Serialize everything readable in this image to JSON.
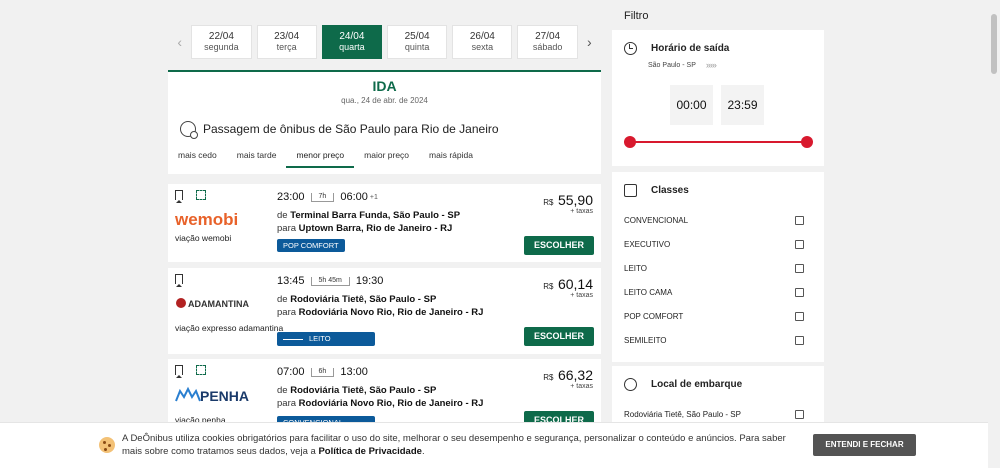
{
  "dates": [
    {
      "date": "22/04",
      "weekday": "segunda",
      "active": false
    },
    {
      "date": "23/04",
      "weekday": "terça",
      "active": false
    },
    {
      "date": "24/04",
      "weekday": "quarta",
      "active": true
    },
    {
      "date": "25/04",
      "weekday": "quinta",
      "active": false
    },
    {
      "date": "26/04",
      "weekday": "sexta",
      "active": false
    },
    {
      "date": "27/04",
      "weekday": "sábado",
      "active": false
    }
  ],
  "trip": {
    "direction": "IDA",
    "date_long": "qua., 24 de abr. de 2024",
    "route_title": "Passagem de ônibus de São Paulo para Rio de Janeiro",
    "sort_options": [
      "mais cedo",
      "mais tarde",
      "menor preço",
      "maior preço",
      "mais rápida"
    ],
    "sort_active": "menor preço"
  },
  "results": [
    {
      "company": "viação wemobi",
      "logo_text": "wemobi",
      "depart": "23:00",
      "duration": "7h",
      "arrive": "06:00",
      "plus_day": "+1",
      "from_prefix": "de",
      "from": "Terminal Barra Funda, São Paulo - SP",
      "to_prefix": "para",
      "to": "Uptown Barra, Rio de Janeiro - RJ",
      "class": "POP COMFORT",
      "currency": "R$",
      "price": "55,90",
      "taxes": "+ taxas",
      "button": "ESCOLHER"
    },
    {
      "company": "viação expresso adamantina",
      "logo_text": "ADAMANTINA",
      "depart": "13:45",
      "duration": "5h 45m",
      "arrive": "19:30",
      "plus_day": "",
      "from_prefix": "de",
      "from": "Rodoviária Tietê, São Paulo - SP",
      "to_prefix": "para",
      "to": "Rodoviária Novo Rio, Rio de Janeiro - RJ",
      "class": "LEITO",
      "currency": "R$",
      "price": "60,14",
      "taxes": "+ taxas",
      "button": "ESCOLHER"
    },
    {
      "company": "viação penha",
      "logo_text": "PENHA",
      "depart": "07:00",
      "duration": "6h",
      "arrive": "13:00",
      "plus_day": "",
      "from_prefix": "de",
      "from": "Rodoviária Tietê, São Paulo - SP",
      "to_prefix": "para",
      "to": "Rodoviária Novo Rio, Rio de Janeiro - RJ",
      "class": "CONVENCIONAL",
      "currency": "R$",
      "price": "66,32",
      "taxes": "+ taxas",
      "button": "ESCOLHER"
    }
  ],
  "filter": {
    "title": "Filtro",
    "departure": {
      "title": "Horário de saída",
      "origin": "São Paulo - SP",
      "chevrons": "›››››",
      "from_time": "00:00",
      "to_time": "23:59",
      "range": [
        0,
        1
      ]
    },
    "classes": {
      "title": "Classes",
      "options": [
        "CONVENCIONAL",
        "EXECUTIVO",
        "LEITO",
        "LEITO CAMA",
        "POP COMFORT",
        "SEMILEITO"
      ]
    },
    "boarding": {
      "title": "Local de embarque",
      "options": [
        "Rodoviária Tietê, São Paulo - SP"
      ]
    }
  },
  "cookie": {
    "text_1": "A DeÔnibus utiliza cookies obrigatórios para facilitar o uso do site, melhorar o seu desempenho e segurança, personalizar o conteúdo e anúncios. Para saber mais sobre como tratamos seus dados, veja a ",
    "link": "Política de Privacidade",
    "text_2": ".",
    "button": "ENTENDI E FECHAR"
  },
  "colors": {
    "brand_green": "#0e6a4a",
    "accent_red": "#d8192e",
    "class_badge_blue": "#0c5a9a"
  }
}
